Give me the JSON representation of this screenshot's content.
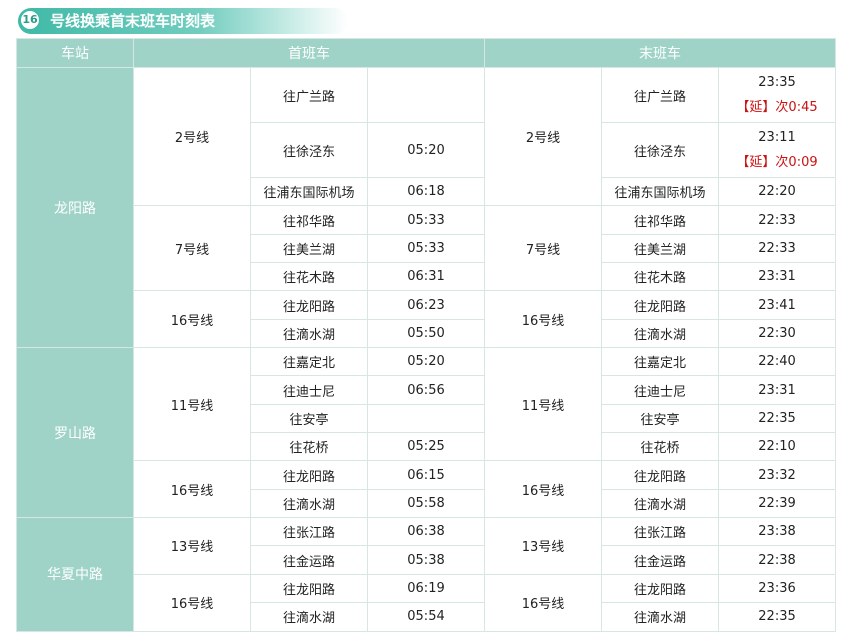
{
  "header": {
    "badge": "16",
    "title": "号线换乘首末班车时刻表"
  },
  "columns": {
    "station": "车站",
    "first": "首班车",
    "last": "末班车"
  },
  "stations": [
    {
      "name": "龙阳路",
      "lines": [
        {
          "line": "2号线",
          "dirs": [
            {
              "dest": "往广兰路",
              "first": "",
              "last": "23:35",
              "last_ext": "【延】次0:45"
            },
            {
              "dest": "往徐泾东",
              "first": "05:20",
              "last": "23:11",
              "last_ext": "【延】次0:09"
            },
            {
              "dest": "往浦东国际机场",
              "first": "06:18",
              "last": "22:20"
            }
          ]
        },
        {
          "line": "7号线",
          "dirs": [
            {
              "dest": "往祁华路",
              "first": "05:33",
              "last": "22:33"
            },
            {
              "dest": "往美兰湖",
              "first": "05:33",
              "last": "22:33"
            },
            {
              "dest": "往花木路",
              "first": "06:31",
              "last": "23:31"
            }
          ]
        },
        {
          "line": "16号线",
          "dirs": [
            {
              "dest": "往龙阳路",
              "first": "06:23",
              "last": "23:41"
            },
            {
              "dest": "往滴水湖",
              "first": "05:50",
              "last": "22:30"
            }
          ]
        }
      ]
    },
    {
      "name": "罗山路",
      "lines": [
        {
          "line": "11号线",
          "dirs": [
            {
              "dest": "往嘉定北",
              "first": "05:20",
              "last": "22:40"
            },
            {
              "dest": "往迪士尼",
              "first": "06:56",
              "last": "23:31"
            },
            {
              "dest": "往安亭",
              "first": "",
              "last": "22:35"
            },
            {
              "dest": "往花桥",
              "first": "05:25",
              "last": "22:10"
            }
          ]
        },
        {
          "line": "16号线",
          "dirs": [
            {
              "dest": "往龙阳路",
              "first": "06:15",
              "last": "23:32"
            },
            {
              "dest": "往滴水湖",
              "first": "05:58",
              "last": "22:39"
            }
          ]
        }
      ]
    },
    {
      "name": "华夏中路",
      "lines": [
        {
          "line": "13号线",
          "dirs": [
            {
              "dest": "往张江路",
              "first": "06:38",
              "last": "23:38"
            },
            {
              "dest": "往金运路",
              "first": "05:38",
              "last": "22:38"
            }
          ]
        },
        {
          "line": "16号线",
          "dirs": [
            {
              "dest": "往龙阳路",
              "first": "06:19",
              "last": "23:36"
            },
            {
              "dest": "往滴水湖",
              "first": "05:54",
              "last": "22:35"
            }
          ]
        }
      ]
    }
  ]
}
